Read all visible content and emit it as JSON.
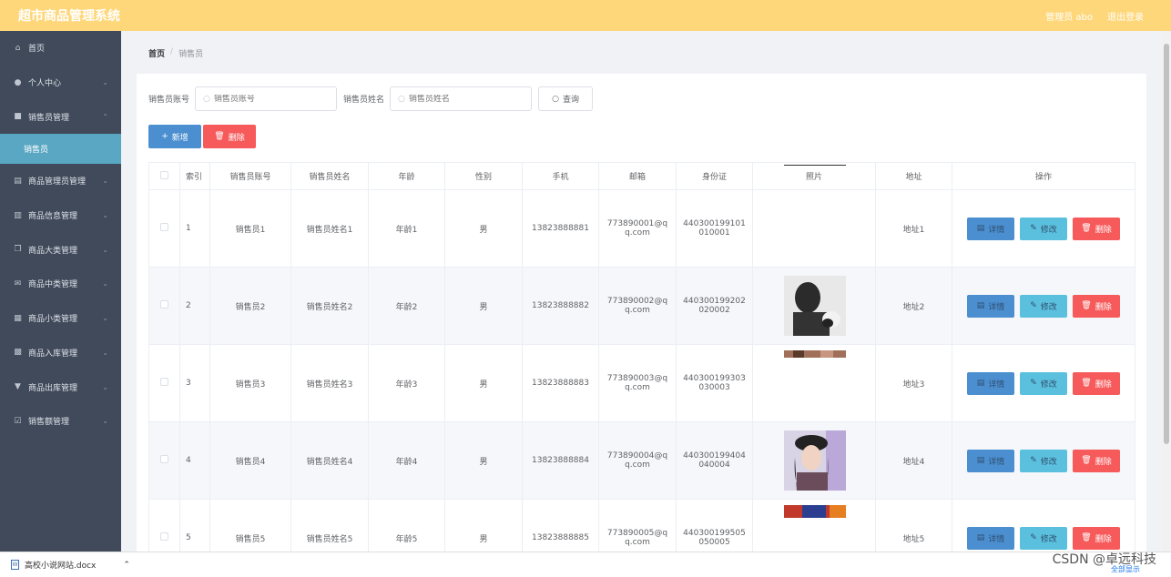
{
  "header": {
    "title": "超市商品管理系统",
    "admin_label": "管理员 abo",
    "logout_label": "退出登录"
  },
  "sidebar": {
    "items": [
      {
        "label": "首页",
        "icon": "home-icon"
      },
      {
        "label": "个人中心",
        "icon": "user-icon"
      },
      {
        "label": "销售员管理",
        "icon": "briefcase-icon"
      },
      {
        "label": "销售员",
        "icon": ""
      },
      {
        "label": "商品管理员管理",
        "icon": "doc-icon"
      },
      {
        "label": "商品信息管理",
        "icon": "bar-chart-icon"
      },
      {
        "label": "商品大类管理",
        "icon": "copy-icon"
      },
      {
        "label": "商品中类管理",
        "icon": "mail-icon"
      },
      {
        "label": "商品小类管理",
        "icon": "columns-icon"
      },
      {
        "label": "商品入库管理",
        "icon": "grid-icon"
      },
      {
        "label": "商品出库管理",
        "icon": "thumbs-icon"
      },
      {
        "label": "销售额管理",
        "icon": "check-icon"
      }
    ]
  },
  "breadcrumb": {
    "home": "首页",
    "current": "销售员"
  },
  "search": {
    "account_label": "销售员账号",
    "account_placeholder": "销售员账号",
    "name_label": "销售员姓名",
    "name_placeholder": "销售员姓名",
    "query_label": "查询"
  },
  "actions": {
    "add_label": "新增",
    "delete_label": "删除"
  },
  "table": {
    "headers": [
      "索引",
      "销售员账号",
      "销售员姓名",
      "年龄",
      "性别",
      "手机",
      "邮箱",
      "身份证",
      "照片",
      "地址",
      "操作"
    ],
    "rows": [
      {
        "index": "1",
        "account": "销售员1",
        "name": "销售员姓名1",
        "age": "年龄1",
        "gender": "男",
        "phone": "13823888881",
        "email1": "773890001@q",
        "email2": "q.com",
        "id1": "440300199101",
        "id2": "010001",
        "address": "地址1"
      },
      {
        "index": "2",
        "account": "销售员2",
        "name": "销售员姓名2",
        "age": "年龄2",
        "gender": "男",
        "phone": "13823888882",
        "email1": "773890002@q",
        "email2": "q.com",
        "id1": "440300199202",
        "id2": "020002",
        "address": "地址2"
      },
      {
        "index": "3",
        "account": "销售员3",
        "name": "销售员姓名3",
        "age": "年龄3",
        "gender": "男",
        "phone": "13823888883",
        "email1": "773890003@q",
        "email2": "q.com",
        "id1": "440300199303",
        "id2": "030003",
        "address": "地址3"
      },
      {
        "index": "4",
        "account": "销售员4",
        "name": "销售员姓名4",
        "age": "年龄4",
        "gender": "男",
        "phone": "13823888884",
        "email1": "773890004@q",
        "email2": "q.com",
        "id1": "440300199404",
        "id2": "040004",
        "address": "地址4"
      },
      {
        "index": "5",
        "account": "销售员5",
        "name": "销售员姓名5",
        "age": "年龄5",
        "gender": "男",
        "phone": "13823888885",
        "email1": "773890005@q",
        "email2": "q.com",
        "id1": "440300199505",
        "id2": "050005",
        "address": "地址5"
      }
    ],
    "op_detail": "详情",
    "op_edit": "修改",
    "op_delete": "删除"
  },
  "download_bar": {
    "file_name": "高校小说网站.docx",
    "show_all": "全部显示"
  },
  "watermark": "CSDN @卓远科技",
  "colors": {
    "topbar": "#fed77a",
    "sidebar": "#404a5a",
    "active_sub": "#5aa7c3",
    "primary": "#4b8fd0",
    "info": "#5bc0de",
    "danger": "#f75a5a"
  }
}
